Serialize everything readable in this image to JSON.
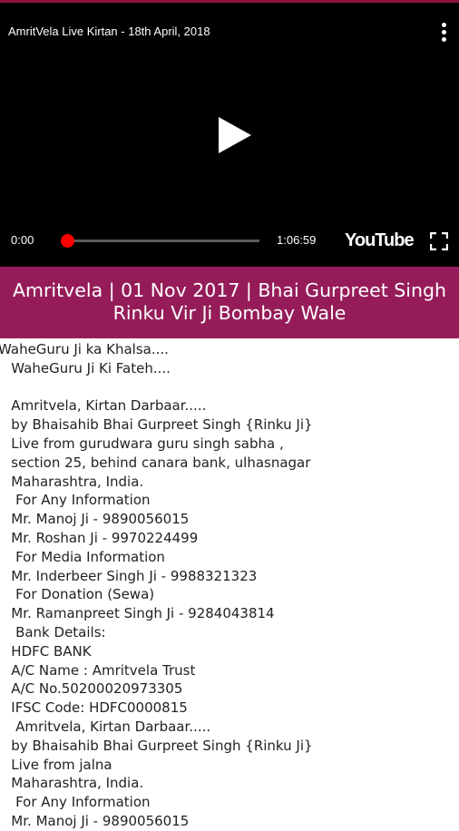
{
  "video": {
    "title": "AmritVela Live Kirtan - 18th April, 2018",
    "current_time": "0:00",
    "duration": "1:06:59",
    "progress_fraction": 0.0,
    "brand": "YouTube",
    "icons": {
      "more": "more-vertical-icon",
      "play": "play-icon",
      "fullscreen": "fullscreen-icon"
    }
  },
  "banner": {
    "title_line1": "Amritvela | 01 Nov 2017 | Bhai Gurpreet Singh",
    "title_line2": "Rinku Vir Ji Bombay Wale",
    "color": "#951c59"
  },
  "description": "WaheGuru Ji ka Khalsa....\n   WaheGuru Ji Ki Fateh....\n\n   Amritvela, Kirtan Darbaar.....\n   by Bhaisahib Bhai Gurpreet Singh {Rinku Ji}\n   Live from gurudwara guru singh sabha ,\n   section 25, behind canara bank, ulhasnagar\n   Maharashtra, India.\n    For Any Information\n   Mr. Manoj Ji - 9890056015\n   Mr. Roshan Ji - 9970224499\n    For Media Information\n   Mr. Inderbeer Singh Ji - 9988321323\n    For Donation (Sewa)\n   Mr. Ramanpreet Singh Ji - 9284043814\n    Bank Details:\n   HDFC BANK\n   A/C Name : Amritvela Trust\n   A/C No.50200020973305\n   IFSC Code: HDFC0000815\n    Amritvela, Kirtan Darbaar.....\n   by Bhaisahib Bhai Gurpreet Singh {Rinku Ji}\n   Live from jalna\n   Maharashtra, India.\n    For Any Information\n   Mr. Manoj Ji - 9890056015"
}
